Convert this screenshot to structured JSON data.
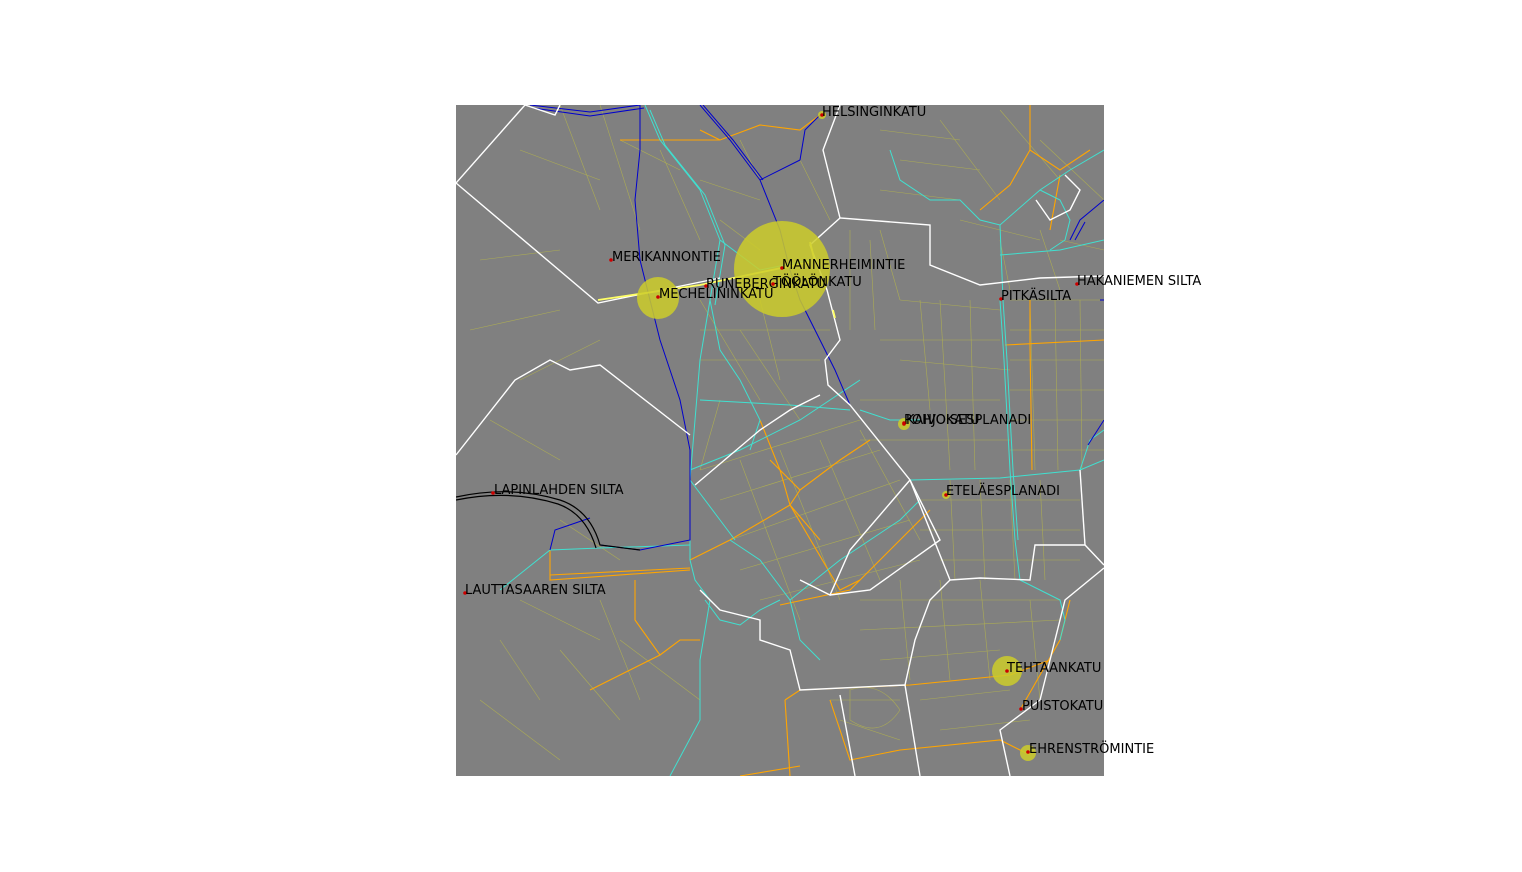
{
  "colors": {
    "map_background": "#808080",
    "page_background": "#ffffff",
    "district_boundary": "#ffffff",
    "minor_street": "#b3b34d",
    "major_street": "#ffa500",
    "tram_line": "#40e0d0",
    "metro_line": "#0000cd",
    "railway": "#000000",
    "point_marker": "#cc0000",
    "bubble_fill": "#cccc2a",
    "highlight_street": "#ffff66"
  },
  "points": [
    {
      "id": "helsinginkatu",
      "label": "HELSINGINKATU",
      "magnitude": "small"
    },
    {
      "id": "merikannontie",
      "label": "MERIKANNONTIE",
      "magnitude": "none"
    },
    {
      "id": "mannerheimintie",
      "label": "MANNERHEIMINTIE",
      "magnitude": "very-large"
    },
    {
      "id": "runeberginkatu",
      "label": "RUNEBERGINKATU",
      "magnitude": "none"
    },
    {
      "id": "toolonkatu",
      "label": "TÖÖLÖNKATU",
      "magnitude": "none"
    },
    {
      "id": "mechelininkatu",
      "label": "MECHELININKATU",
      "magnitude": "large"
    },
    {
      "id": "hakaniemen-silta",
      "label": "HAKANIEMEN SILTA",
      "magnitude": "none"
    },
    {
      "id": "pitkasilta",
      "label": "PITKÄSILTA",
      "magnitude": "none"
    },
    {
      "id": "pohjoisesplanadi",
      "label": "POHJOISESPLANADI",
      "magnitude": "small"
    },
    {
      "id": "kaivokatu",
      "label": "KAIVOKATU",
      "magnitude": "small"
    },
    {
      "id": "etelaesplanadi",
      "label": "ETELÄESPLANADI",
      "magnitude": "small"
    },
    {
      "id": "lapinlahden-silta",
      "label": "LAPINLAHDEN SILTA",
      "magnitude": "none"
    },
    {
      "id": "lauttasaaren-silta",
      "label": "LAUTTASAAREN SILTA",
      "magnitude": "none"
    },
    {
      "id": "tehtaankatu",
      "label": "TEHTAANKATU",
      "magnitude": "medium"
    },
    {
      "id": "puistokatu",
      "label": "PUISTOKATU",
      "magnitude": "none"
    },
    {
      "id": "ehrenstromintie",
      "label": "EHRENSTRÖMINTIE",
      "magnitude": "small"
    }
  ]
}
